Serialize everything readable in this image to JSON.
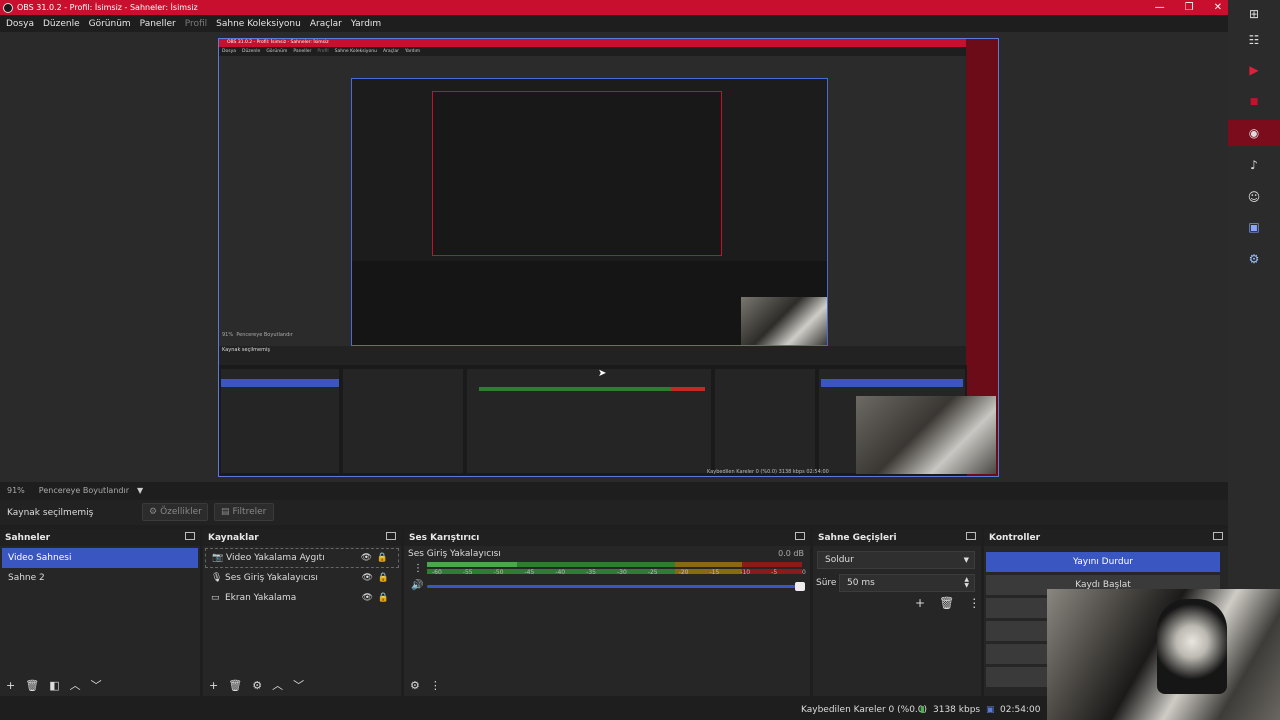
{
  "window": {
    "title": "OBS 31.0.2 - Profil: İsimsiz - Sahneler: İsimsiz",
    "minimize": "—",
    "restore": "❐",
    "close": "✕"
  },
  "menu": [
    "Dosya",
    "Düzenle",
    "Görünüm",
    "Paneller",
    "Profil",
    "Sahne Koleksiyonu",
    "Araçlar",
    "Yardım"
  ],
  "nested_preview": {
    "title": "OBS 31.0.2 - Profil: İsimsiz - Sahneler: İsimsiz",
    "menu": [
      "Dosya",
      "Düzenle",
      "Görünüm",
      "Paneller",
      "Profil",
      "Sahne Koleksiyonu",
      "Araçlar",
      "Yardım"
    ],
    "zoom": "91%",
    "fit": "Pencereye Boyutlandır",
    "nosrc": "Kaynak seçilmemiş",
    "status": "Kaybedilen Kareler 0 (%0.0)   3138 kbps   02:54:00"
  },
  "strip": {
    "zoom": "91%",
    "fit_label": "Pencereye Boyutlandır",
    "caret": "▼"
  },
  "props_bar": {
    "no_source": "Kaynak seçilmemiş",
    "properties": "Özellikler",
    "filters": "Filtreler"
  },
  "scenes": {
    "title": "Sahneler",
    "items": [
      "Video Sahnesi",
      "Sahne 2"
    ],
    "selected": 0
  },
  "sources": {
    "title": "Kaynaklar",
    "items": [
      {
        "name": "Video Yakalama Aygıtı",
        "icon": "camera-icon"
      },
      {
        "name": "Ses Giriş Yakalayıcısı",
        "icon": "microphone-icon"
      },
      {
        "name": "Ekran Yakalama",
        "icon": "monitor-icon"
      }
    ]
  },
  "mixer": {
    "title": "Ses Karıştırıcı",
    "channel": "Ses Giriş Yakalayıcısı",
    "db": "0.0 dB",
    "ticks": [
      "-60",
      "-55",
      "-50",
      "-45",
      "-40",
      "-35",
      "-30",
      "-25",
      "-20",
      "-15",
      "-10",
      "-5",
      "0"
    ],
    "level": 0.24,
    "volume": 1.0
  },
  "transitions": {
    "title": "Sahne Geçişleri",
    "type": "Soldur",
    "duration_label": "Süre",
    "duration": "50 ms"
  },
  "controls": {
    "title": "Kontroller",
    "stream": "Yayını Durdur",
    "record": "Kaydı Başlat"
  },
  "status": {
    "dropped": "Kaybedilen Kareler 0 (%0.0)",
    "bitrate": "3138 kbps",
    "time": "02:54:00"
  },
  "sidebar_icons": [
    "windows-icon",
    "layout-icon",
    "youtube-icon",
    "kick-icon",
    "obs-icon",
    "tiktok-icon",
    "discord-icon",
    "stream-deck-icon",
    "steam-icon"
  ],
  "colors": {
    "accent": "#3a56c0",
    "title": "#c8102e",
    "sidebar_active": "#7a0c1c"
  }
}
